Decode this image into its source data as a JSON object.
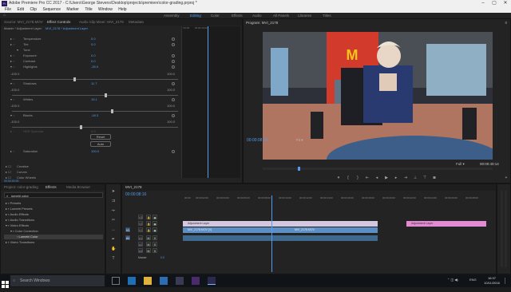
{
  "titlebar": {
    "title": "Adobe Premiere Pro CC 2017 - C:\\Users\\George Stevens\\Desktop\\projects\\premiere\\color-grading.prproj *",
    "app_icon": "Pr"
  },
  "menu": [
    "File",
    "Edit",
    "Clip",
    "Sequence",
    "Marker",
    "Title",
    "Window",
    "Help"
  ],
  "workspaces": [
    "Assembly",
    "Editing",
    "Color",
    "Effects",
    "Audio",
    "All Panels",
    "Libraries",
    "Titles"
  ],
  "active_workspace": "Editing",
  "effect_controls": {
    "tabs": [
      "Source: MVI_2178.MOV",
      "Effect Controls",
      "Audio Clip Mixer: MVI_2178",
      "Metadata"
    ],
    "master": "Master * Adjustment Layer",
    "clip": "MVI_2178 * Adjustment Layer",
    "rows": [
      {
        "label": "Temperature",
        "value": "0.0"
      },
      {
        "label": "Tint",
        "value": "0.0"
      },
      {
        "label": "Tone",
        "value": ""
      },
      {
        "label": "Exposure",
        "value": "0.0"
      },
      {
        "label": "Contrast",
        "value": "0.0"
      },
      {
        "label": "Highlights",
        "value": "-26.0"
      },
      {
        "label": "Shadows",
        "value": "11.7"
      },
      {
        "label": "Whites",
        "value": "19.1"
      },
      {
        "label": "Blacks",
        "value": "-18.3"
      },
      {
        "label": "HDR Specular",
        "value": "0.0"
      },
      {
        "label": "Saturation",
        "value": "100.0"
      }
    ],
    "slider_min": "-100.0",
    "slider_max": "100.0",
    "reset_label": "Reset",
    "auto_label": "Auto",
    "sections": [
      "Creative",
      "Curves",
      "Color Wheels"
    ],
    "timecode": "00:00:00:00"
  },
  "program_monitor": {
    "title": "Program: MVI_2178",
    "timecode_left": "00:00:08:16",
    "fit": "Fit",
    "quality": "Full",
    "timecode_right": "00:00:40:14",
    "sign_text": "McDonald's"
  },
  "project": {
    "tabs": [
      "Project: color-grading",
      "Effects",
      "Media Browser"
    ],
    "search_value": "lumetri color",
    "tree": [
      {
        "label": "Presets",
        "indent": 0
      },
      {
        "label": "Lumetri Presets",
        "indent": 0
      },
      {
        "label": "Audio Effects",
        "indent": 0
      },
      {
        "label": "Audio Transitions",
        "indent": 0
      },
      {
        "label": "Video Effects",
        "indent": 0
      },
      {
        "label": "Color Correction",
        "indent": 1
      },
      {
        "label": "Lumetri Color",
        "indent": 2
      },
      {
        "label": "Video Transitions",
        "indent": 0
      }
    ]
  },
  "timeline": {
    "tab": "MVI_2178",
    "timecode": "00:00:08:16",
    "ruler": [
      "00:00",
      "00:00:02:00",
      "00:00:04:00",
      "00:00:06:00",
      "00:00:08:00",
      "00:00:10:00",
      "00:00:12:00",
      "00:00:14:00",
      "00:00:16:00",
      "00:00:18:00",
      "00:00:20:00",
      "00:00:22:00",
      "00:00:24:00",
      "00:00:26:00",
      "00:00:28:00"
    ],
    "tracks": [
      "V3",
      "V2",
      "V1",
      "A1",
      "A2",
      "A3"
    ],
    "clips": {
      "adjustment": "Adjustment Layer",
      "adjustment2": "Adjustment Layer",
      "video1": "MVI_2178.MOV [V]",
      "video2": "MVI_2178.MOV",
      "audio_master_value": "0.0"
    }
  },
  "taskbar": {
    "search_placeholder": "Search Windows",
    "time": "16:37",
    "date": "10/11/2016",
    "language": "ENG"
  },
  "colors": {
    "accent": "#4f9cf2",
    "adjustment_clip": "#d4c8e0",
    "video_clip": "#5b8fc6",
    "pink_clip": "#e48ad3",
    "audio_clip": "#3d6a8e"
  }
}
